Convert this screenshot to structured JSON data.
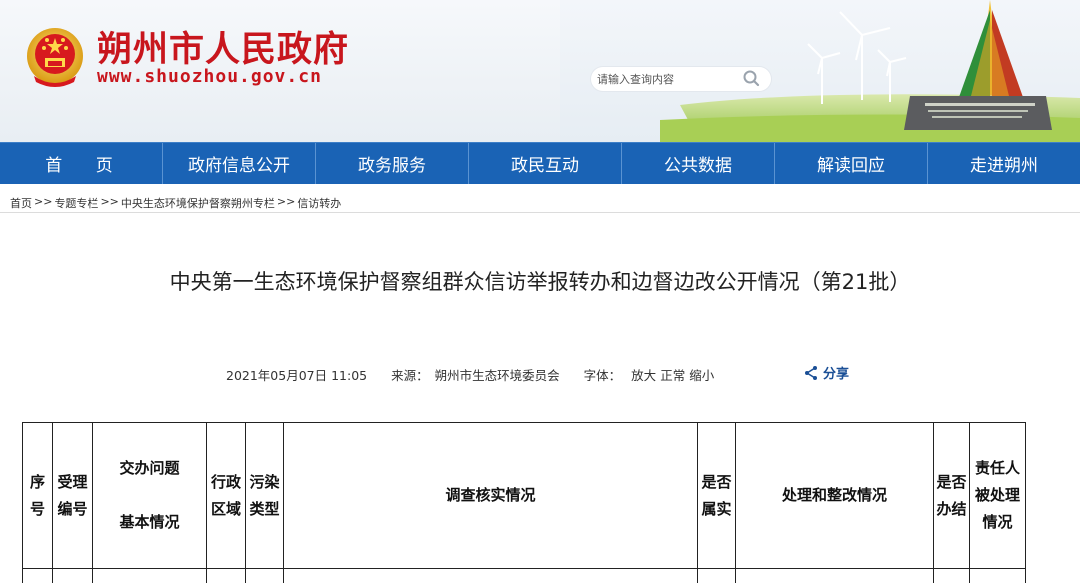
{
  "site": {
    "name": "朔州市人民政府",
    "url": "www.shuozhou.gov.cn"
  },
  "search": {
    "placeholder": "请输入查询内容",
    "button_icon": "search-icon"
  },
  "nav": {
    "items": [
      {
        "label": "首 页"
      },
      {
        "label": "政府信息公开"
      },
      {
        "label": "政务服务"
      },
      {
        "label": "政民互动"
      },
      {
        "label": "公共数据"
      },
      {
        "label": "解读回应"
      },
      {
        "label": "走进朔州"
      }
    ]
  },
  "breadcrumb": {
    "items": [
      {
        "label": "首页"
      },
      {
        "label": "专题专栏"
      },
      {
        "label": "中央生态环境保护督察朔州专栏"
      },
      {
        "label": "信访转办"
      }
    ],
    "separator": ">>"
  },
  "article": {
    "title": "中央第一生态环境保护督察组群众信访举报转办和边督边改公开情况（第21批）",
    "date": "2021年05月07日 11:05",
    "source_label": "来源：",
    "source": "朔州市生态环境委员会",
    "font_label": "字体：",
    "font_large": "放大",
    "font_normal": "正常",
    "font_small": "缩小",
    "share_label": "分享"
  },
  "table": {
    "headers": [
      {
        "line1": "序",
        "line2": "号"
      },
      {
        "line1": "受理",
        "line2": "编号"
      },
      {
        "line1": "交办问题",
        "line2": "基本情况"
      },
      {
        "line1": "行政",
        "line2": "区域"
      },
      {
        "line1": "污染",
        "line2": "类型"
      },
      {
        "line1": "调查核实情况",
        "line2": ""
      },
      {
        "line1": "是否",
        "line2": "属实"
      },
      {
        "line1": "处理和整改情况",
        "line2": ""
      },
      {
        "line1": "是否",
        "line2": "办结"
      },
      {
        "line1": "责任人",
        "line2": "被处理",
        "line3": "情况"
      }
    ]
  },
  "colors": {
    "brand_red": "#c8161d",
    "nav_blue": "#1a63b5"
  }
}
